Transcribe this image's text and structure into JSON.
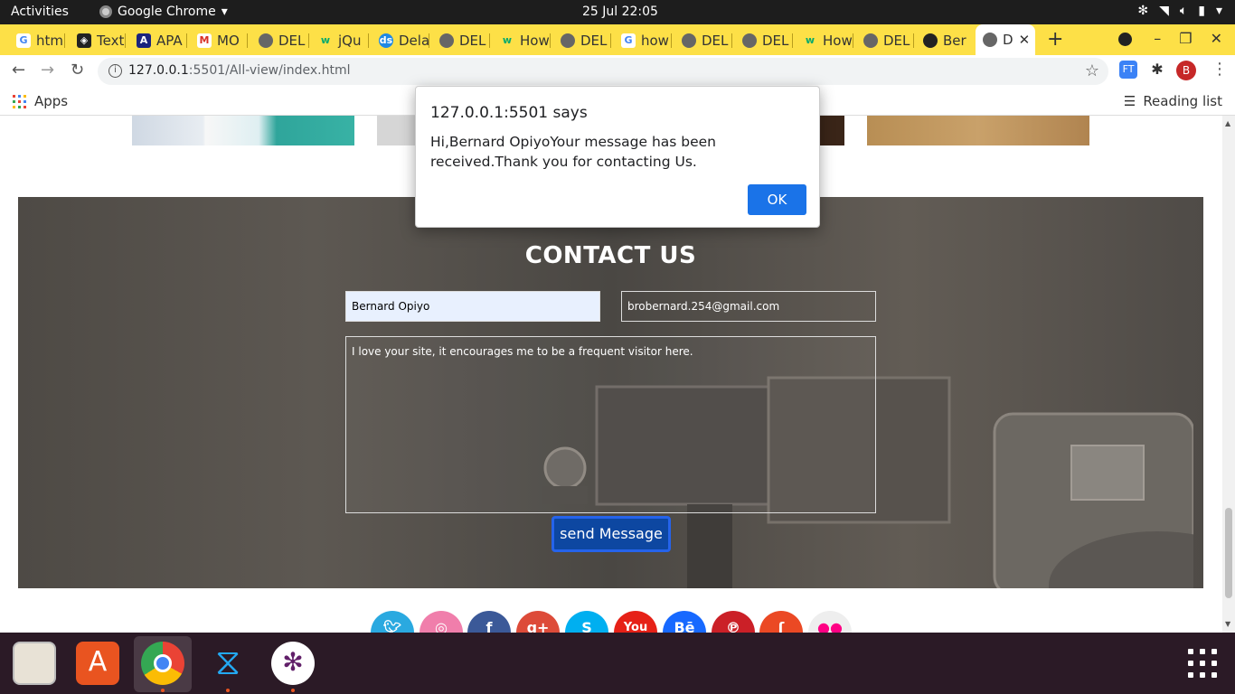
{
  "topbar": {
    "activities": "Activities",
    "app_name": "Google Chrome",
    "clock": "25 Jul  22:05"
  },
  "tabs": [
    {
      "label": "htm",
      "icon": "google-icon"
    },
    {
      "label": "Text",
      "icon": "codepen-icon"
    },
    {
      "label": "APA",
      "icon": "apa-icon"
    },
    {
      "label": "MO",
      "icon": "gmail-icon"
    },
    {
      "label": "DEL",
      "icon": "globe-icon"
    },
    {
      "label": "jQu",
      "icon": "w3schools-icon"
    },
    {
      "label": "Dela",
      "icon": "ds-icon"
    },
    {
      "label": "DEL",
      "icon": "globe-icon"
    },
    {
      "label": "How",
      "icon": "w3schools-icon"
    },
    {
      "label": "DEL",
      "icon": "globe-icon"
    },
    {
      "label": "how",
      "icon": "google-icon"
    },
    {
      "label": "DEL",
      "icon": "globe-icon"
    },
    {
      "label": "DEL",
      "icon": "globe-icon"
    },
    {
      "label": "How",
      "icon": "w3schools-icon"
    },
    {
      "label": "DEL",
      "icon": "globe-icon"
    },
    {
      "label": "Ber",
      "icon": "github-icon"
    },
    {
      "label": "D",
      "icon": "globe-icon",
      "active": true
    }
  ],
  "address": {
    "host": "127.0.0.1",
    "path": ":5501/All-view/index.html"
  },
  "bookmarks": {
    "apps": "Apps",
    "reading_list": "Reading list"
  },
  "contact": {
    "heading": "CONTACT US",
    "name_value": "Bernard Opiyo",
    "email_value": "brobernard.254@gmail.com",
    "message_value": "I love your site, it encourages me to be a frequent visitor here.",
    "send_label": "send Message"
  },
  "social_icons": [
    "twitter-icon",
    "dribbble-icon",
    "facebook-icon",
    "google-plus-icon",
    "skype-icon",
    "youtube-icon",
    "behance-icon",
    "pinterest-icon",
    "stumbleupon-icon",
    "flickr-icon"
  ],
  "social_labels": {
    "google_plus": "g+",
    "youtube": "You",
    "behance": "Bē"
  },
  "alert": {
    "title": "127.0.0.1:5501 says",
    "message": "Hi,Bernard OpiyoYour message has been received.Thank you for contacting Us.",
    "ok_label": "OK"
  },
  "colors": {
    "tabstrip": "#fde047",
    "taskbar": "#2b1a26",
    "send_button": "#0d47a1",
    "ok_button": "#1a73e8"
  }
}
